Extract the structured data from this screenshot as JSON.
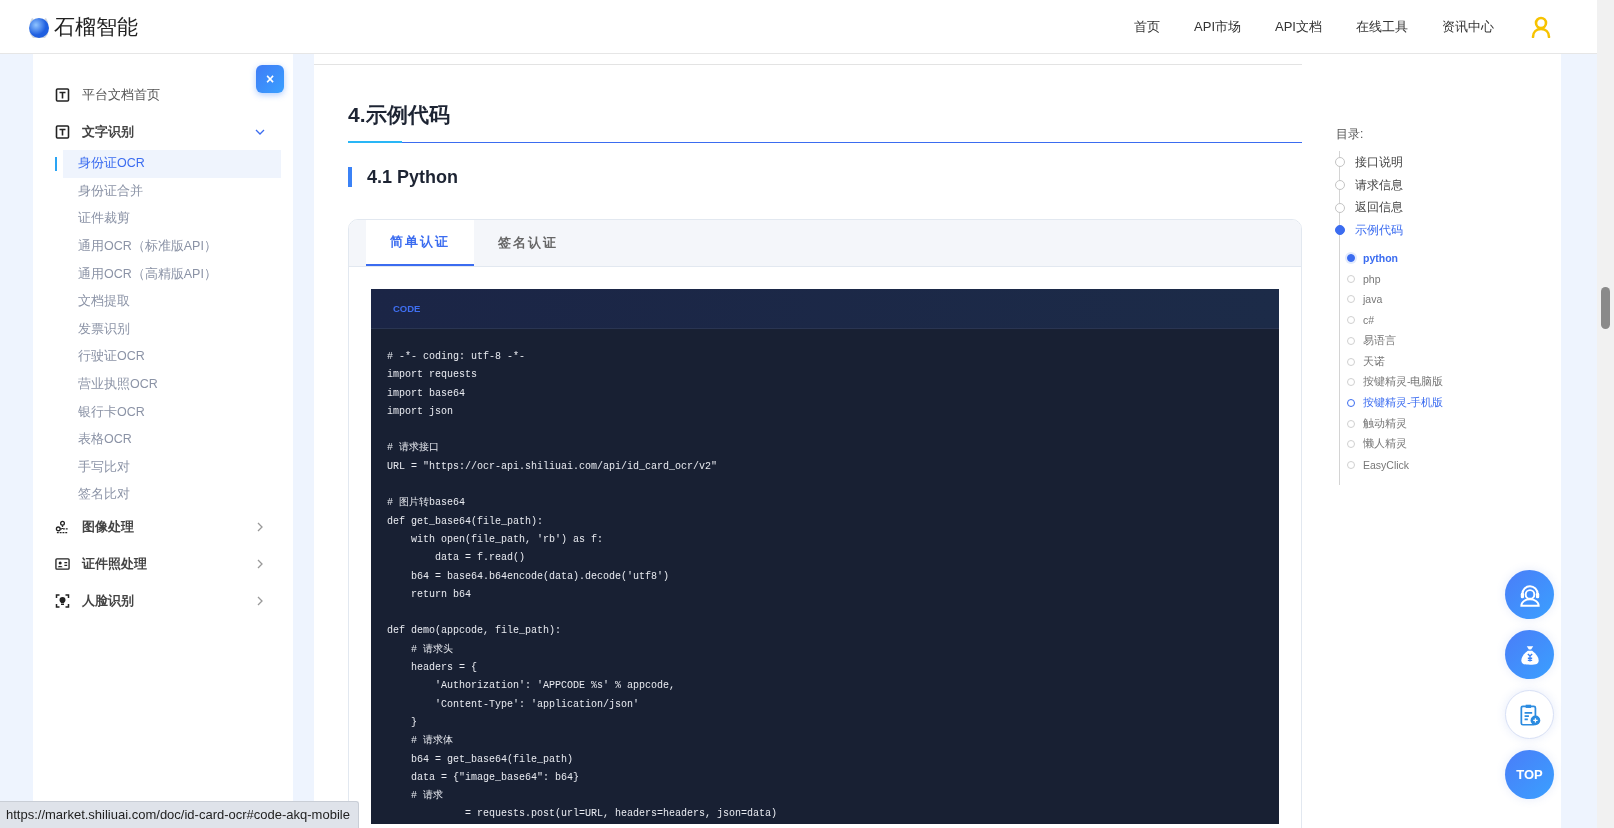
{
  "header": {
    "brand": "石榴智能",
    "nav": [
      {
        "label": "首页"
      },
      {
        "label": "API市场"
      },
      {
        "label": "API文档"
      },
      {
        "label": "在线工具"
      },
      {
        "label": "资讯中心"
      }
    ]
  },
  "sidebar": {
    "close": "×",
    "items": [
      {
        "label": "平台文档首页",
        "kind": "text"
      },
      {
        "label": "文字识别",
        "kind": "text",
        "expanded": true,
        "children": [
          {
            "label": "身份证OCR",
            "selected": true
          },
          {
            "label": "身份证合并",
            "selected": false
          },
          {
            "label": "证件裁剪",
            "selected": false
          },
          {
            "label": "通用OCR（标准版API）",
            "selected": false
          },
          {
            "label": "通用OCR（高精版API）",
            "selected": false
          },
          {
            "label": "文档提取",
            "selected": false
          },
          {
            "label": "发票识别",
            "selected": false
          },
          {
            "label": "行驶证OCR",
            "selected": false
          },
          {
            "label": "营业执照OCR",
            "selected": false
          },
          {
            "label": "银行卡OCR",
            "selected": false
          },
          {
            "label": "表格OCR",
            "selected": false
          },
          {
            "label": "手写比对",
            "selected": false
          },
          {
            "label": "签名比对",
            "selected": false
          }
        ]
      },
      {
        "label": "图像处理",
        "kind": "image",
        "expanded": false
      },
      {
        "label": "证件照处理",
        "kind": "idcard",
        "expanded": false
      },
      {
        "label": "人脸识别",
        "kind": "face",
        "expanded": false
      }
    ]
  },
  "content": {
    "heading": "4.示例代码",
    "subheading": "4.1 Python",
    "tabs": [
      {
        "label": "简单认证",
        "selected": true
      },
      {
        "label": "签名认证",
        "selected": false
      }
    ],
    "code_label": "CODE",
    "code": "# -*- coding: utf-8 -*-\nimport requests\nimport base64\nimport json\n\n# 请求接口\nURL = \"https://ocr-api.shiliuai.com/api/id_card_ocr/v2\"\n\n# 图片转base64\ndef get_base64(file_path):\n    with open(file_path, 'rb') as f:\n        data = f.read()\n    b64 = base64.b64encode(data).decode('utf8')\n    return b64\n\ndef demo(appcode, file_path):\n    # 请求头\n    headers = {\n        'Authorization': 'APPCODE %s' % appcode,\n        'Content-Type': 'application/json'\n    }\n    # 请求体\n    b64 = get_base64(file_path)\n    data = {\"image_base64\": b64}\n    # 请求\n             = requests.post(url=URL, headers=headers, json=data)"
  },
  "toc": {
    "title": "目录:",
    "items": [
      {
        "label": "接口说明",
        "selected": false
      },
      {
        "label": "请求信息",
        "selected": false
      },
      {
        "label": "返回信息",
        "selected": false
      },
      {
        "label": "示例代码",
        "selected": true,
        "children": [
          {
            "label": "python",
            "selected": true,
            "hovered": false
          },
          {
            "label": "php",
            "selected": false,
            "hovered": false
          },
          {
            "label": "java",
            "selected": false,
            "hovered": false
          },
          {
            "label": "c#",
            "selected": false,
            "hovered": false
          },
          {
            "label": "易语言",
            "selected": false,
            "hovered": false
          },
          {
            "label": "天诺",
            "selected": false,
            "hovered": false
          },
          {
            "label": "按键精灵-电脑版",
            "selected": false,
            "hovered": false
          },
          {
            "label": "按键精灵-手机版",
            "selected": false,
            "hovered": true
          },
          {
            "label": "触动精灵",
            "selected": false,
            "hovered": false
          },
          {
            "label": "懒人精灵",
            "selected": false,
            "hovered": false
          },
          {
            "label": "EasyClick",
            "selected": false,
            "hovered": false
          }
        ]
      }
    ]
  },
  "float_buttons": [
    {
      "kind": "support"
    },
    {
      "kind": "money"
    },
    {
      "kind": "clipboard"
    },
    {
      "kind": "top",
      "label": "TOP"
    }
  ],
  "status_bar": {
    "url": "https://market.shiliuai.com/doc/id-card-ocr#code-akq-mobile"
  }
}
